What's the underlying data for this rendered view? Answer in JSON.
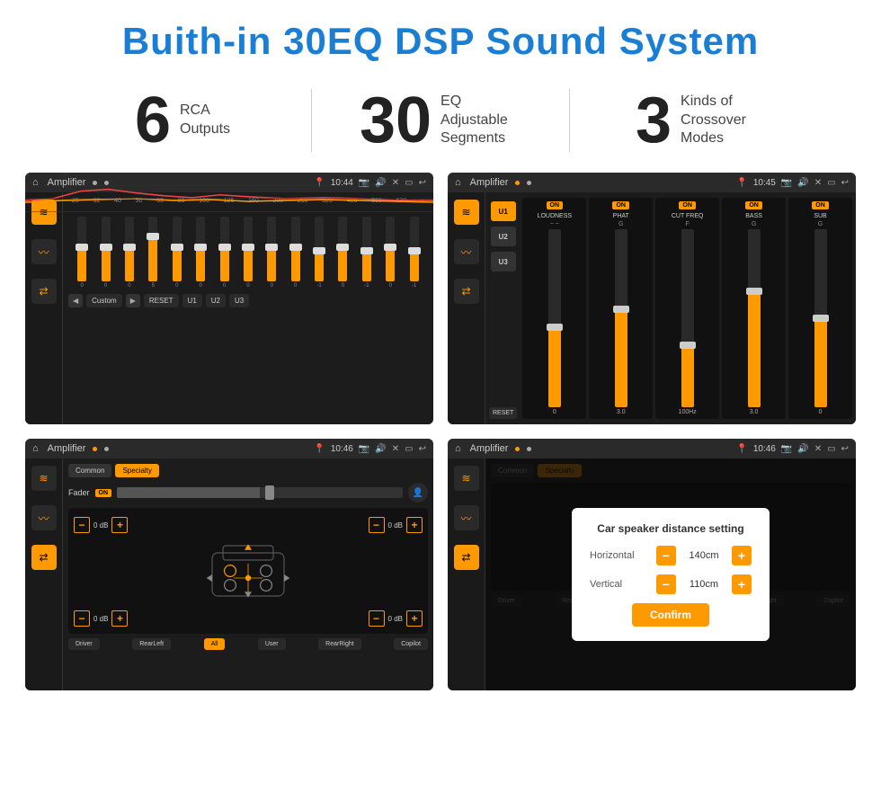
{
  "header": {
    "title": "Buith-in 30EQ DSP Sound System"
  },
  "stats": [
    {
      "number": "6",
      "desc_line1": "RCA",
      "desc_line2": "Outputs"
    },
    {
      "number": "30",
      "desc_line1": "EQ Adjustable",
      "desc_line2": "Segments"
    },
    {
      "number": "3",
      "desc_line1": "Kinds of",
      "desc_line2": "Crossover Modes"
    }
  ],
  "screens": [
    {
      "id": "eq-screen",
      "topbar": {
        "title": "Amplifier",
        "time": "10:44"
      },
      "type": "eq"
    },
    {
      "id": "crossover-screen",
      "topbar": {
        "title": "Amplifier",
        "time": "10:45"
      },
      "type": "crossover"
    },
    {
      "id": "fader-screen",
      "topbar": {
        "title": "Amplifier",
        "time": "10:46"
      },
      "type": "fader"
    },
    {
      "id": "distance-screen",
      "topbar": {
        "title": "Amplifier",
        "time": "10:46"
      },
      "type": "distance",
      "modal": {
        "title": "Car speaker distance setting",
        "horizontal_label": "Horizontal",
        "horizontal_value": "140cm",
        "vertical_label": "Vertical",
        "vertical_value": "110cm",
        "confirm_label": "Confirm"
      }
    }
  ],
  "eq": {
    "frequencies": [
      "25",
      "32",
      "40",
      "50",
      "63",
      "80",
      "100",
      "125",
      "160",
      "200",
      "250",
      "320",
      "400",
      "500",
      "630"
    ],
    "values": [
      "0",
      "0",
      "0",
      "5",
      "0",
      "0",
      "0",
      "0",
      "0",
      "0",
      "-1",
      "0",
      "-1",
      "0",
      "0"
    ],
    "bottom_btns": [
      "Custom",
      "RESET",
      "U1",
      "U2",
      "U3"
    ]
  },
  "crossover": {
    "presets": [
      "U1",
      "U2",
      "U3"
    ],
    "channels": [
      {
        "label": "LOUDNESS",
        "on": true
      },
      {
        "label": "PHAT",
        "on": true
      },
      {
        "label": "CUT FREQ",
        "on": true
      },
      {
        "label": "BASS",
        "on": true
      },
      {
        "label": "SUB",
        "on": true
      }
    ],
    "reset_label": "RESET"
  },
  "fader": {
    "tabs": [
      "Common",
      "Specialty"
    ],
    "fader_label": "Fader",
    "on_badge": "ON",
    "db_values": [
      "0 dB",
      "0 dB",
      "0 dB",
      "0 dB"
    ],
    "bottom_btns": [
      "Driver",
      "RearLeft",
      "All",
      "User",
      "RearRight",
      "Copilot"
    ]
  },
  "distance_modal": {
    "title": "Car speaker distance setting",
    "horizontal": "Horizontal",
    "horizontal_val": "140cm",
    "vertical": "Vertical",
    "vertical_val": "110cm",
    "confirm": "Confirm"
  }
}
